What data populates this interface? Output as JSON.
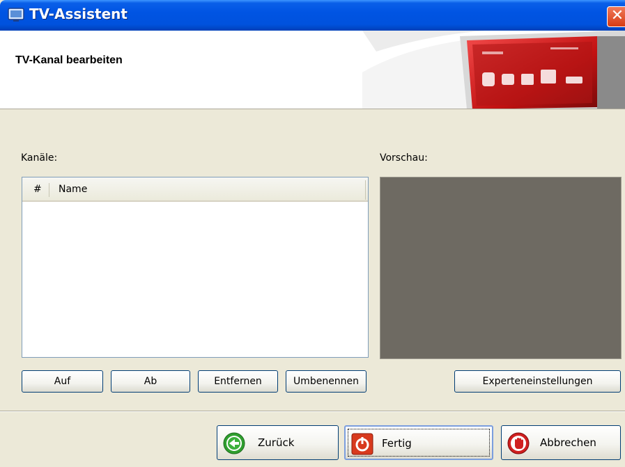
{
  "window": {
    "title": "TV-Assistent",
    "close_glyph": "✕"
  },
  "banner": {
    "heading": "TV-Kanal bearbeiten"
  },
  "channels": {
    "label": "Kanäle:",
    "columns": [
      "#",
      "Name"
    ],
    "rows": []
  },
  "preview": {
    "label": "Vorschau:"
  },
  "list_buttons": {
    "up": "Auf",
    "down": "Ab",
    "remove": "Entfernen",
    "rename": "Umbenennen"
  },
  "expert_button": "Experteneinstellungen",
  "nav": {
    "back": "Zurück",
    "finish": "Fertig",
    "cancel": "Abbrechen"
  },
  "icons": {
    "title": "tv-app-icon",
    "back": "green-back-arrow-icon",
    "finish": "red-power-icon",
    "cancel": "red-stop-hand-icon"
  },
  "colors": {
    "titlebar": "#0054e3",
    "preview_bg": "#6e6a62",
    "accent_red": "#d02020"
  }
}
